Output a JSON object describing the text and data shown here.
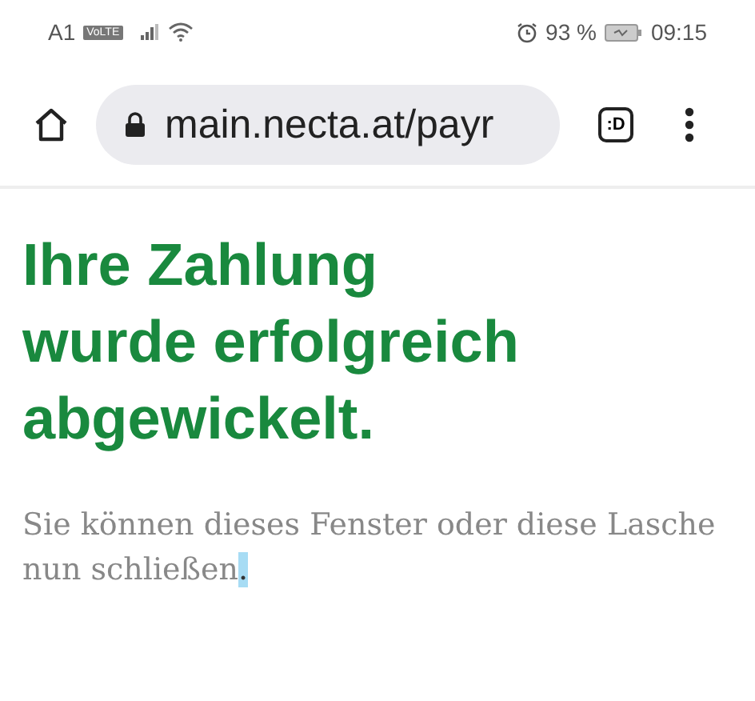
{
  "status_bar": {
    "carrier": "A1",
    "volte": "VoLTE",
    "battery_percent": "93 %",
    "time": "09:15"
  },
  "browser_toolbar": {
    "url": "main.necta.at/payr",
    "tab_count": ":D"
  },
  "page": {
    "heading": "Ihre Zahlung wurde erfolgreich abgewickelt.",
    "message": {
      "text": "Sie können dieses Fenster oder diese Lasche nun schließen",
      "selected_text": "."
    }
  }
}
